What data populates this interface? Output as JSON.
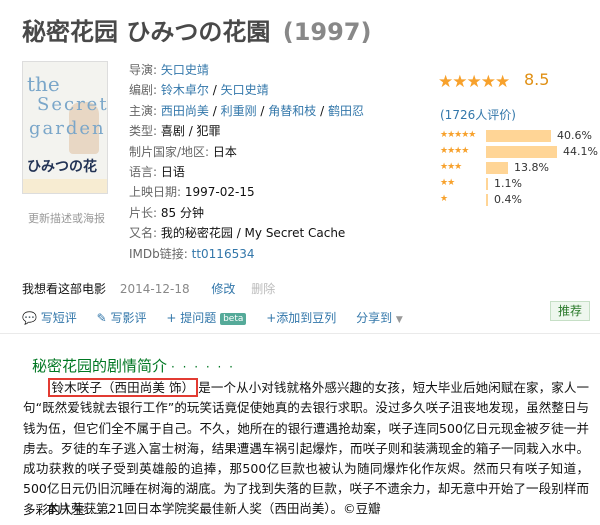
{
  "title": {
    "main": "秘密花园 ひみつの花園",
    "year": "(1997)"
  },
  "poster": {
    "the": "the",
    "secret": "Secret",
    "garden": "garden",
    "jp": "ひみつの花園",
    "more_link": "更新描述或海报"
  },
  "info": {
    "director": {
      "label": "导演:",
      "value": "矢口史靖"
    },
    "writer": {
      "label": "编剧:",
      "v1": "铃木卓尔",
      "sep": " / ",
      "v2": "矢口史靖"
    },
    "cast": {
      "label": "主演:",
      "v1": "西田尚美",
      "v2": "利重刚",
      "v3": "角替和枝",
      "v4": "鹤田忍",
      "sep": " / "
    },
    "genre": {
      "label": "类型:",
      "value": "喜剧 / 犯罪"
    },
    "country": {
      "label": "制片国家/地区:",
      "value": "日本"
    },
    "language": {
      "label": "语言:",
      "value": "日语"
    },
    "release": {
      "label": "上映日期:",
      "value": "1997-02-15"
    },
    "runtime": {
      "label": "片长:",
      "value": "85 分钟"
    },
    "aka": {
      "label": "又名:",
      "value": "我的秘密花园 / My Secret Cache"
    },
    "imdb": {
      "label": "IMDb链接:",
      "value": "tt0116534"
    }
  },
  "rating": {
    "stars": "★★★★★",
    "score": "8.5",
    "count_text": "(1726人评价)",
    "distribution": [
      {
        "stars": "★★★★★",
        "pct": "40.6%",
        "fraction": 0.406
      },
      {
        "stars": "★★★★",
        "pct": "44.1%",
        "fraction": 0.441
      },
      {
        "stars": "★★★",
        "pct": "13.8%",
        "fraction": 0.138
      },
      {
        "stars": "★★",
        "pct": "1.1%",
        "fraction": 0.011
      },
      {
        "stars": "★",
        "pct": "0.4%",
        "fraction": 0.004
      }
    ]
  },
  "wish": {
    "label": "我想看这部电影",
    "date": "2014-12-18",
    "edit": "修改",
    "delete": "删除"
  },
  "actions": {
    "short_review": "写短评",
    "review": "写影评",
    "question": "+ 提问题",
    "beta": "beta",
    "add_list": "+添加到豆列",
    "share": "分享到"
  },
  "recommend": "推荐",
  "synopsis": {
    "title": "秘密花园的剧情简介",
    "dots": "· · · · · ·",
    "highlight": "铃木咲子（西田尚美 饰）",
    "text": "是一个从小对钱就格外感兴趣的女孩，短大毕业后她闲赋在家，家人一句“既然爱钱就去银行工作”的玩笑话竟促使她真的去银行求职。没过多久咲子沮丧地发现，虽然整日与钱为伍，但它们全不属于自己。不久，她所在的银行遭遇抢劫案，咲子连同500亿日元现金被歹徒一并虏去。歹徒的车子逃入富士树海，结果遭遇车祸引起爆炸，而咲子则和装满现金的箱子一同栽入水中。成功获救的咲子受到英雄般的追捧，那500亿巨款也被认为随同爆炸化作灰烬。然而只有咲子知道，500亿日元仍旧沉睡在树海的湖底。为了找到失落的巨款，咲子不遗余力，却无意中开始了一段别样而多彩的人生……",
    "award": "本片荣获第21回日本学院奖最佳新人奖（西田尚美）。©豆瓣"
  },
  "colors": {
    "accent": "#3377aa",
    "star": "#f7a12c",
    "score": "#e09015",
    "bar": "#ffd596",
    "section": "#007722",
    "highlight_border": "#e23b32"
  }
}
